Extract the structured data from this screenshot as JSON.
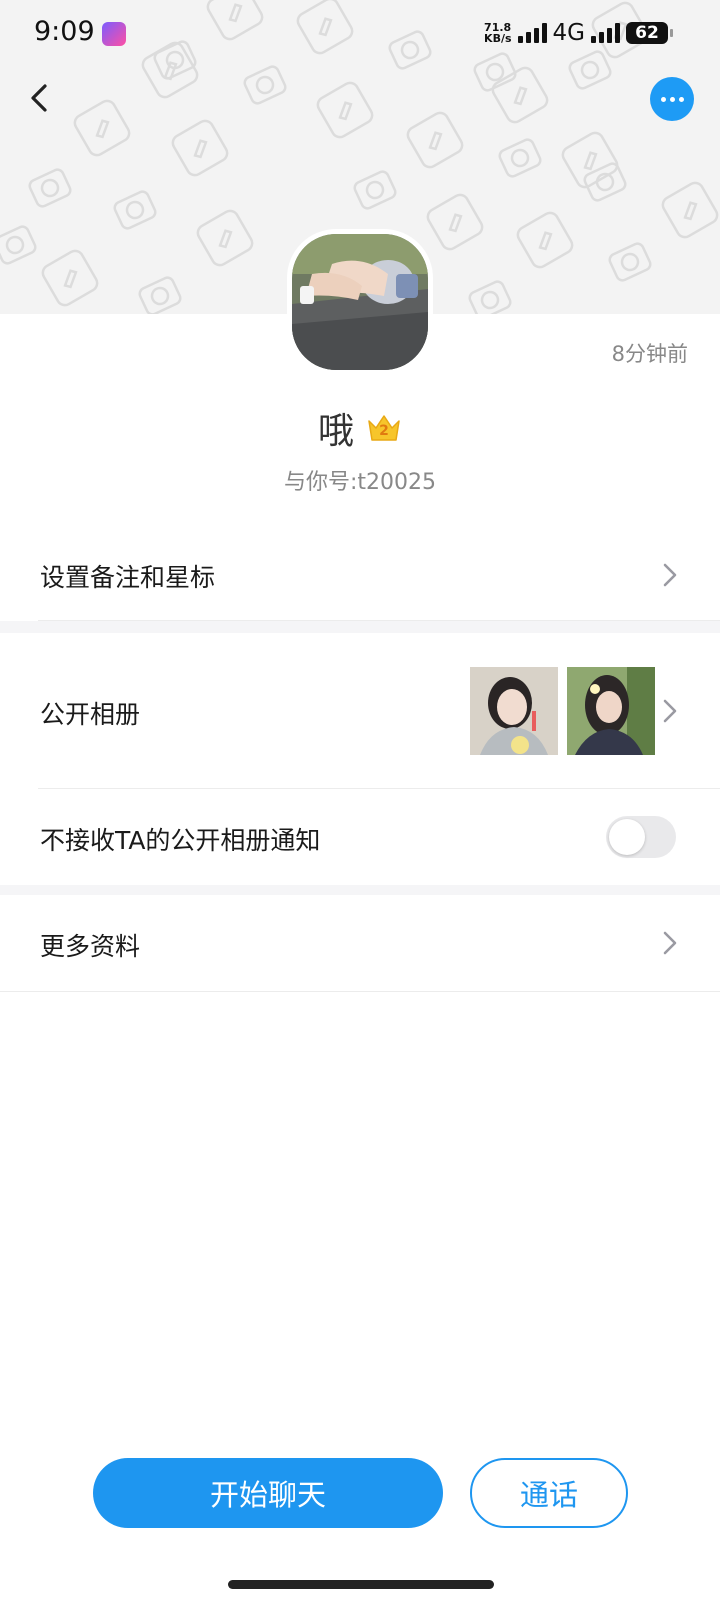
{
  "status_bar": {
    "time": "9:09",
    "net_speed_value": "71.8",
    "net_speed_unit": "KB/s",
    "network_type": "4G",
    "battery": "62"
  },
  "header": {
    "back_icon": "chevron-left-icon",
    "more_icon": "ellipsis-icon"
  },
  "profile": {
    "last_seen": "8分钟前",
    "nickname": "哦",
    "vip_level": "2",
    "account_id": "与你号:t20025"
  },
  "menu": {
    "remark": "设置备注和星标",
    "album": "公开相册",
    "album_notify": "不接收TA的公开相册通知",
    "album_notify_enabled": false,
    "more_info": "更多资料"
  },
  "actions": {
    "chat": "开始聊天",
    "call": "通话"
  },
  "colors": {
    "accent": "#1e96f0",
    "header_bg": "#f3f3f3"
  }
}
